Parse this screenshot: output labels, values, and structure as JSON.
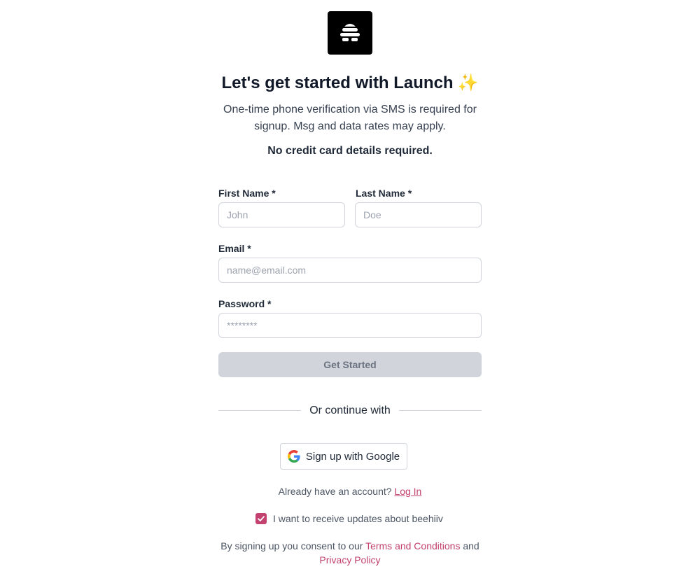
{
  "logo": {
    "icon": "beehive-logo-icon"
  },
  "header": {
    "title": "Let's get started with Launch",
    "sparkle": "✨",
    "subtitle": "One-time phone verification via SMS is required for signup. Msg and data rates may apply.",
    "notice": "No credit card details required."
  },
  "form": {
    "first_name": {
      "label": "First Name *",
      "placeholder": "John",
      "value": ""
    },
    "last_name": {
      "label": "Last Name *",
      "placeholder": "Doe",
      "value": ""
    },
    "email": {
      "label": "Email *",
      "placeholder": "name@email.com",
      "value": ""
    },
    "password": {
      "label": "Password *",
      "placeholder": "********",
      "value": ""
    },
    "submit_label": "Get Started"
  },
  "divider": {
    "text": "Or continue with"
  },
  "google": {
    "label": "Sign up with Google",
    "icon": "google-icon"
  },
  "account": {
    "prompt": "Already have an account?",
    "login_label": "Log In"
  },
  "updates": {
    "checked": true,
    "label": "I want to receive updates about beehiiv"
  },
  "consent": {
    "prefix": "By signing up you consent to our",
    "terms_label": "Terms and Conditions",
    "and": "and",
    "privacy_label": "Privacy Policy"
  },
  "colors": {
    "accent": "#c2416e",
    "button_disabled": "#d1d5db",
    "text_dark": "#111827"
  }
}
